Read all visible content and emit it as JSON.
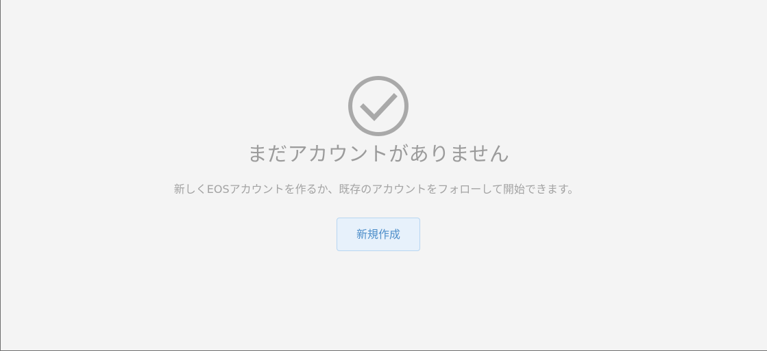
{
  "empty_state": {
    "icon": "check-circle-icon",
    "title": "まだアカウントがありません",
    "description": "新しくEOSアカウントを作るか、既存のアカウントをフォローして開始できます。",
    "create_button_label": "新規作成"
  },
  "colors": {
    "background": "#f4f4f4",
    "icon": "#a9a9a9",
    "text_muted": "#9b9b9b",
    "button_background": "#e7f1fb",
    "button_border": "#b7d6f1",
    "button_text": "#4f8fca"
  }
}
